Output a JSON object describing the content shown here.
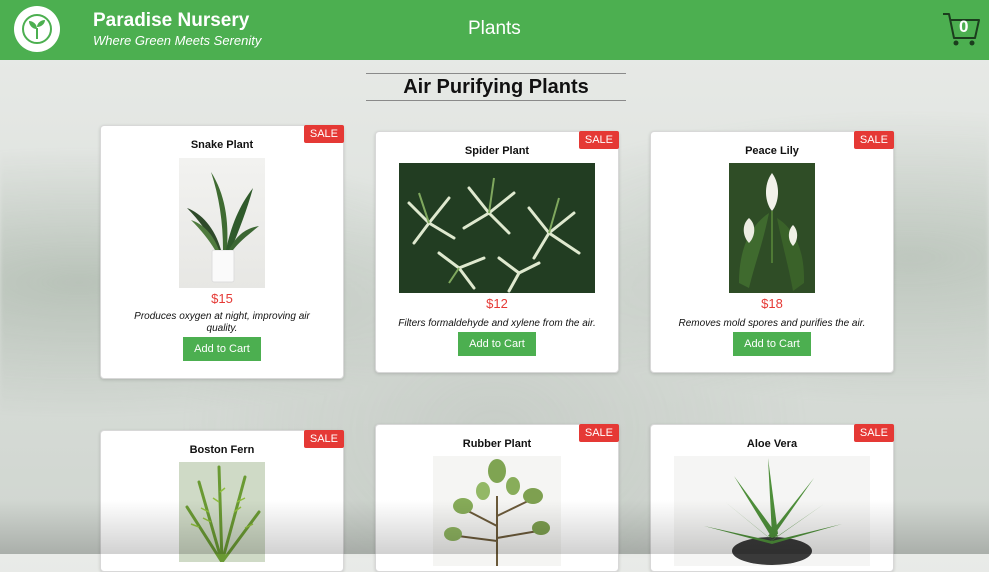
{
  "header": {
    "brand_name": "Paradise Nursery",
    "brand_tagline": "Where Green Meets Serenity",
    "nav_plants": "Plants",
    "cart_count": "0",
    "logo_icon": "sprout-icon",
    "cart_icon": "shopping-cart-icon",
    "accent_color": "#4caf50"
  },
  "section": {
    "title": "Air Purifying Plants"
  },
  "products": [
    {
      "name": "Snake Plant",
      "price": "$15",
      "description": "Produces oxygen at night, improving air quality.",
      "badge": "SALE",
      "button": "Add to Cart"
    },
    {
      "name": "Spider Plant",
      "price": "$12",
      "description": "Filters formaldehyde and xylene from the air.",
      "badge": "SALE",
      "button": "Add to Cart"
    },
    {
      "name": "Peace Lily",
      "price": "$18",
      "description": "Removes mold spores and purifies the air.",
      "badge": "SALE",
      "button": "Add to Cart"
    },
    {
      "name": "Boston Fern",
      "badge": "SALE"
    },
    {
      "name": "Rubber Plant",
      "badge": "SALE"
    },
    {
      "name": "Aloe Vera",
      "badge": "SALE"
    }
  ],
  "colors": {
    "sale": "#e53935",
    "price": "#e53935",
    "button": "#4caf50"
  }
}
